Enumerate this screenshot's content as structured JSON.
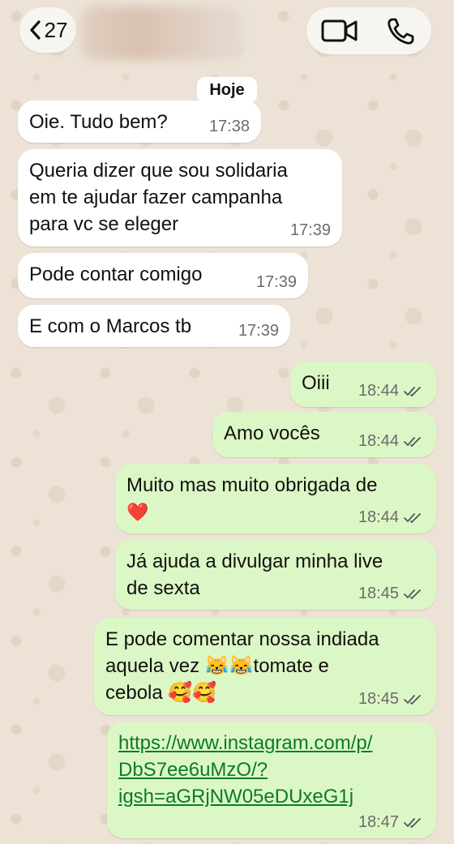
{
  "header": {
    "back_count": "27",
    "icons": {
      "back": "chevron-left-icon",
      "video": "video-camera-icon",
      "phone": "phone-icon"
    }
  },
  "date_separator": "Hoje",
  "messages": [
    {
      "direction": "in",
      "lines": [
        "Oie. Tudo bem?"
      ],
      "time": "17:38"
    },
    {
      "direction": "in",
      "lines": [
        "Queria dizer que sou solidaria",
        "em te ajudar fazer campanha",
        "para vc se eleger"
      ],
      "time": "17:39"
    },
    {
      "direction": "in",
      "lines": [
        "Pode contar comigo"
      ],
      "time": "17:39"
    },
    {
      "direction": "in",
      "lines": [
        "E com o Marcos tb"
      ],
      "time": "17:39"
    },
    {
      "direction": "out",
      "lines": [
        "Oiii"
      ],
      "time": "18:44",
      "status": "read"
    },
    {
      "direction": "out",
      "lines": [
        "Amo vocês"
      ],
      "time": "18:44",
      "status": "read"
    },
    {
      "direction": "out",
      "lines": [
        "Muito mas muito obrigada de",
        "❤️"
      ],
      "time": "18:44",
      "status": "read"
    },
    {
      "direction": "out",
      "lines": [
        "Já ajuda a divulgar minha live",
        "de sexta"
      ],
      "time": "18:45",
      "status": "read"
    },
    {
      "direction": "out",
      "lines": [
        "E pode comentar nossa indiada",
        "aquela vez 😹😹tomate e",
        "cebola 🥰🥰"
      ],
      "time": "18:45",
      "status": "read"
    },
    {
      "direction": "out",
      "lines": [
        "https://www.instagram.com/p/",
        "DbS7ee6uMzO/?",
        "igsh=aGRjNW05eDUxeG1j"
      ],
      "time": "18:47",
      "status": "read",
      "is_link": true
    }
  ],
  "colors": {
    "incoming_bubble": "#ffffff",
    "outgoing_bubble": "#dcf7c6",
    "link": "#0b7a2a",
    "timestamp": "#6b6b6b",
    "wallpaper": "#ece3d6"
  }
}
